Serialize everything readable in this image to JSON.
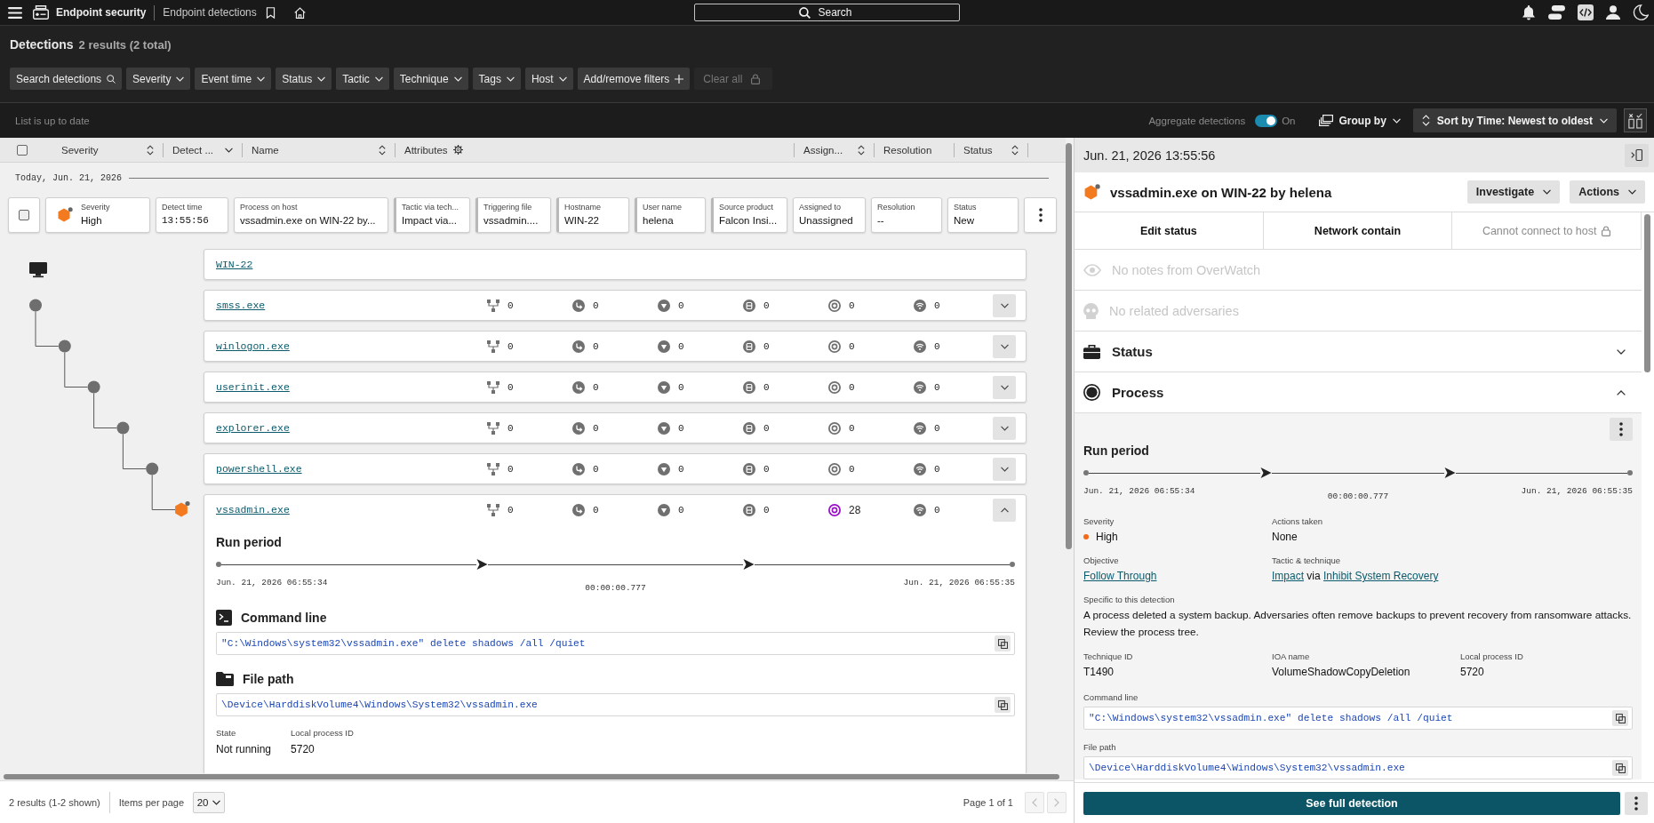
{
  "top_bar": {
    "app_name": "Endpoint security",
    "page_name": "Endpoint detections",
    "search": {
      "placeholder": "Search"
    }
  },
  "header": {
    "title": "Detections",
    "count": "2 results (2 total)",
    "filters": [
      {
        "label": "Search detections",
        "kind": "search"
      },
      {
        "label": "Severity",
        "kind": "dropdown"
      },
      {
        "label": "Event time",
        "kind": "dropdown"
      },
      {
        "label": "Status",
        "kind": "dropdown"
      },
      {
        "label": "Tactic",
        "kind": "dropdown"
      },
      {
        "label": "Technique",
        "kind": "dropdown"
      },
      {
        "label": "Tags",
        "kind": "dropdown"
      },
      {
        "label": "Host",
        "kind": "dropdown"
      },
      {
        "label": "Add/remove filters",
        "kind": "add"
      },
      {
        "label": "Clear all",
        "kind": "locked"
      }
    ]
  },
  "toolbar": {
    "status": "List is up to date",
    "aggregate": {
      "label": "Aggregate detections",
      "on": true,
      "state_label": "On"
    },
    "group_by": "Group by",
    "sort": "Sort by Time: Newest to oldest"
  },
  "table": {
    "select_all": {
      "checked": false
    },
    "columns": [
      {
        "label": "Severity",
        "kind": "sortable"
      },
      {
        "label": "Detect ...",
        "kind": "sorted"
      },
      {
        "label": "Name",
        "kind": "sortable"
      },
      {
        "label": "Attributes",
        "kind": "settings"
      },
      {
        "label": "Assign...",
        "kind": "sortable"
      },
      {
        "label": "Resolution",
        "kind": "plain"
      },
      {
        "label": "Status",
        "kind": "sortable"
      }
    ]
  },
  "group_label": "Today, Jun. 21, 2026",
  "detection": {
    "checked": false,
    "fields": [
      {
        "label": "Severity",
        "value": "High",
        "kind": "severity"
      },
      {
        "label": "Detect time",
        "value": "13:55:56",
        "kind": "time"
      },
      {
        "label": "Process on host",
        "value": "vssadmin.exe on WIN-22 by...",
        "kind": "text"
      },
      {
        "label": "Tactic via tech...",
        "value": "Impact via...",
        "kind": "attribute"
      },
      {
        "label": "Triggering file",
        "value": "vssadmin....",
        "kind": "attribute"
      },
      {
        "label": "Hostname",
        "value": "WIN-22",
        "kind": "attribute"
      },
      {
        "label": "User name",
        "value": "helena",
        "kind": "attribute"
      },
      {
        "label": "Source product",
        "value": "Falcon Insi...",
        "kind": "attribute"
      },
      {
        "label": "Assigned to",
        "value": "Unassigned",
        "kind": "text"
      },
      {
        "label": "Resolution",
        "value": "--",
        "kind": "text"
      },
      {
        "label": "Status",
        "value": "New",
        "kind": "text"
      }
    ]
  },
  "process_tree": {
    "host": "WIN-22",
    "children": [
      {
        "name": "smss.exe",
        "detection": false,
        "expanded": false,
        "metrics": [
          {
            "count": "0",
            "highlighted": false
          },
          {
            "count": "0",
            "highlighted": false
          },
          {
            "count": "0",
            "highlighted": false
          },
          {
            "count": "0",
            "highlighted": false
          },
          {
            "count": "0",
            "highlighted": false
          },
          {
            "count": "0",
            "highlighted": false
          }
        ],
        "children": [
          {
            "name": "winlogon.exe",
            "detection": false,
            "expanded": false,
            "metrics": [
              {
                "count": "0",
                "highlighted": false
              },
              {
                "count": "0",
                "highlighted": false
              },
              {
                "count": "0",
                "highlighted": false
              },
              {
                "count": "0",
                "highlighted": false
              },
              {
                "count": "0",
                "highlighted": false
              },
              {
                "count": "0",
                "highlighted": false
              }
            ],
            "children": [
              {
                "name": "userinit.exe",
                "detection": false,
                "expanded": false,
                "metrics": [
                  {
                    "count": "0",
                    "highlighted": false
                  },
                  {
                    "count": "0",
                    "highlighted": false
                  },
                  {
                    "count": "0",
                    "highlighted": false
                  },
                  {
                    "count": "0",
                    "highlighted": false
                  },
                  {
                    "count": "0",
                    "highlighted": false
                  },
                  {
                    "count": "0",
                    "highlighted": false
                  }
                ],
                "children": [
                  {
                    "name": "explorer.exe",
                    "detection": false,
                    "expanded": false,
                    "metrics": [
                      {
                        "count": "0",
                        "highlighted": false
                      },
                      {
                        "count": "0",
                        "highlighted": false
                      },
                      {
                        "count": "0",
                        "highlighted": false
                      },
                      {
                        "count": "0",
                        "highlighted": false
                      },
                      {
                        "count": "0",
                        "highlighted": false
                      },
                      {
                        "count": "0",
                        "highlighted": false
                      }
                    ],
                    "children": [
                      {
                        "name": "powershell.exe",
                        "detection": false,
                        "expanded": false,
                        "metrics": [
                          {
                            "count": "0",
                            "highlighted": false
                          },
                          {
                            "count": "0",
                            "highlighted": false
                          },
                          {
                            "count": "0",
                            "highlighted": false
                          },
                          {
                            "count": "0",
                            "highlighted": false
                          },
                          {
                            "count": "0",
                            "highlighted": false
                          },
                          {
                            "count": "0",
                            "highlighted": false
                          }
                        ],
                        "children": [
                          {
                            "name": "vssadmin.exe",
                            "detection": true,
                            "expanded": true,
                            "metrics": [
                              {
                                "count": "0",
                                "highlighted": false
                              },
                              {
                                "count": "0",
                                "highlighted": false
                              },
                              {
                                "count": "0",
                                "highlighted": false
                              },
                              {
                                "count": "0",
                                "highlighted": false
                              },
                              {
                                "count": "28",
                                "highlighted": true
                              },
                              {
                                "count": "0",
                                "highlighted": false
                              }
                            ],
                            "details": {
                              "run_period": {
                                "title": "Run period",
                                "start": "Jun. 21, 2026 06:55:34",
                                "duration": "00:00:00.777",
                                "end": "Jun. 21, 2026 06:55:35"
                              },
                              "blocks": [
                                {
                                  "title": "Command line",
                                  "kind": "terminal",
                                  "value": "\"C:\\Windows\\system32\\vssadmin.exe\" delete shadows /all /quiet"
                                },
                                {
                                  "title": "File path",
                                  "kind": "folder",
                                  "value": "\\Device\\HarddiskVolume4\\Windows\\System32\\vssadmin.exe"
                                }
                              ],
                              "facts": [
                                {
                                  "label": "State",
                                  "value": "Not running"
                                },
                                {
                                  "label": "Local process ID",
                                  "value": "5720"
                                }
                              ]
                            }
                          }
                        ]
                      }
                    ]
                  }
                ]
              }
            ]
          }
        ]
      }
    ]
  },
  "pagination": {
    "results": "2 results (1-2 shown)",
    "per_page_label": "Items per page",
    "per_page": "20",
    "page": "Page 1 of 1",
    "nav": [
      {
        "kind": "previous",
        "disabled": true
      },
      {
        "kind": "next",
        "disabled": true
      }
    ]
  },
  "detail_panel": {
    "timestamp": "Jun. 21, 2026 13:55:56",
    "title": "vssadmin.exe on WIN-22 by helena",
    "menus": [
      "Investigate",
      "Actions"
    ],
    "actions": [
      {
        "label": "Edit status",
        "disabled": false
      },
      {
        "label": "Network contain",
        "disabled": false
      },
      {
        "label": "Cannot connect to host",
        "disabled": true
      }
    ],
    "notices": [
      {
        "label": "No notes from OverWatch",
        "kind": "overwatch"
      },
      {
        "label": "No related adversaries",
        "kind": "adversaries"
      }
    ],
    "sections": [
      {
        "title": "Status",
        "kind": "status",
        "expanded": false
      },
      {
        "title": "Process",
        "kind": "process",
        "expanded": true
      }
    ],
    "process": {
      "run_period": {
        "title": "Run period",
        "start": "Jun. 21, 2026 06:55:34",
        "duration": "00:00:00.777",
        "end": "Jun. 21, 2026 06:55:35"
      },
      "rows": [
        [
          {
            "label": "Severity",
            "kind": "severity",
            "value": "High"
          },
          {
            "label": "Actions taken",
            "kind": "text",
            "value": "None"
          }
        ],
        [
          {
            "label": "Objective",
            "kind": "link",
            "value": "Follow Through"
          },
          {
            "label": "Tactic & technique",
            "kind": "links",
            "parts": [
              {
                "text": "Impact",
                "kind": "link"
              },
              {
                "text": "via",
                "kind": "text"
              },
              {
                "text": "Inhibit System Recovery",
                "kind": "link"
              }
            ]
          }
        ],
        [
          {
            "label": "Specific to this detection",
            "kind": "paragraph",
            "value": "A process deleted a system backup. Adversaries often remove backups to prevent recovery from ransomware attacks. Review the process tree."
          }
        ],
        [
          {
            "label": "Technique ID",
            "kind": "text",
            "value": "T1490"
          },
          {
            "label": "IOA name",
            "kind": "text",
            "value": "VolumeShadowCopyDeletion"
          },
          {
            "label": "Local process ID",
            "kind": "text",
            "value": "5720"
          }
        ]
      ],
      "code_fields": [
        {
          "label": "Command line",
          "value": "\"C:\\Windows\\system32\\vssadmin.exe\" delete shadows /all /quiet"
        },
        {
          "label": "File path",
          "value": "\\Device\\HarddiskVolume4\\Windows\\System32\\vssadmin.exe"
        }
      ]
    },
    "primary_button": "See full detection"
  }
}
